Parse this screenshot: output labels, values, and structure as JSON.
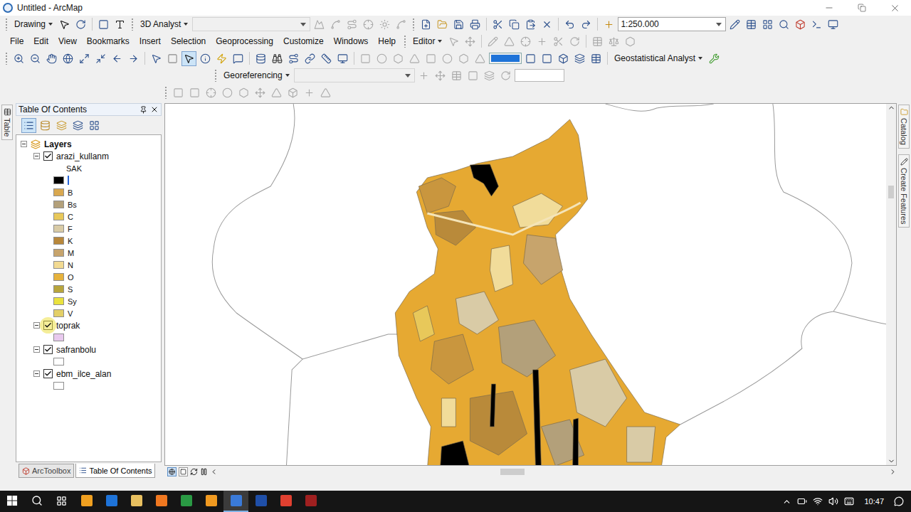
{
  "window": {
    "title": "Untitled - ArcMap"
  },
  "toolbars": {
    "drawing": {
      "label": "Drawing"
    },
    "analyst": {
      "label": "3D Analyst",
      "disabled": true
    },
    "standard": {
      "scale": "1:250.000"
    },
    "menu": [
      "File",
      "Edit",
      "View",
      "Bookmarks",
      "Insert",
      "Selection",
      "Geoprocessing",
      "Customize",
      "Windows",
      "Help"
    ],
    "editor": {
      "label": "Editor",
      "disabled": true
    },
    "geostatistical": {
      "label": "Geostatistical Analyst"
    },
    "georeferencing": {
      "label": "Georeferencing",
      "disabled": true
    },
    "spatial": {
      "disabled": true
    }
  },
  "side_tabs_left": [
    "Table"
  ],
  "side_tabs_right": [
    "Catalog",
    "Create Features"
  ],
  "toc": {
    "title": "Table Of Contents",
    "root": {
      "label": "Layers",
      "expanded": true
    },
    "layers": [
      {
        "name": "arazi_kullanm",
        "checked": true,
        "expanded": true,
        "highlighted": false,
        "field": "SAK",
        "classes": [
          {
            "label": "",
            "color": "#000000",
            "editing": true
          },
          {
            "label": "B",
            "color": "#d9a84f",
            "editing": false
          },
          {
            "label": "Bs",
            "color": "#b3a07a",
            "editing": false
          },
          {
            "label": "C",
            "color": "#e8c85a",
            "editing": false
          },
          {
            "label": "F",
            "color": "#d9cba6",
            "editing": false
          },
          {
            "label": "K",
            "color": "#b8873a",
            "editing": false
          },
          {
            "label": "M",
            "color": "#c7a46c",
            "editing": false
          },
          {
            "label": "N",
            "color": "#f2da92",
            "editing": false
          },
          {
            "label": "O",
            "color": "#e6b23c",
            "editing": false
          },
          {
            "label": "S",
            "color": "#b8a53c",
            "editing": false
          },
          {
            "label": "Sy",
            "color": "#eae23e",
            "editing": false
          },
          {
            "label": "V",
            "color": "#e3cf66",
            "editing": false
          }
        ]
      },
      {
        "name": "toprak",
        "checked": true,
        "expanded": true,
        "highlighted": true,
        "symbol": "#e8c9ee"
      },
      {
        "name": "safranbolu",
        "checked": true,
        "expanded": true,
        "highlighted": false,
        "symbol": "#ffffff"
      },
      {
        "name": "ebm_ilce_alan",
        "checked": true,
        "expanded": true,
        "highlighted": false,
        "symbol": "#ffffff"
      }
    ]
  },
  "bottom_tabs": [
    {
      "label": "ArcToolbox",
      "selected": false
    },
    {
      "label": "Table Of Contents",
      "selected": true
    }
  ],
  "taskbar": {
    "time": "10:47",
    "active_app": 6
  }
}
